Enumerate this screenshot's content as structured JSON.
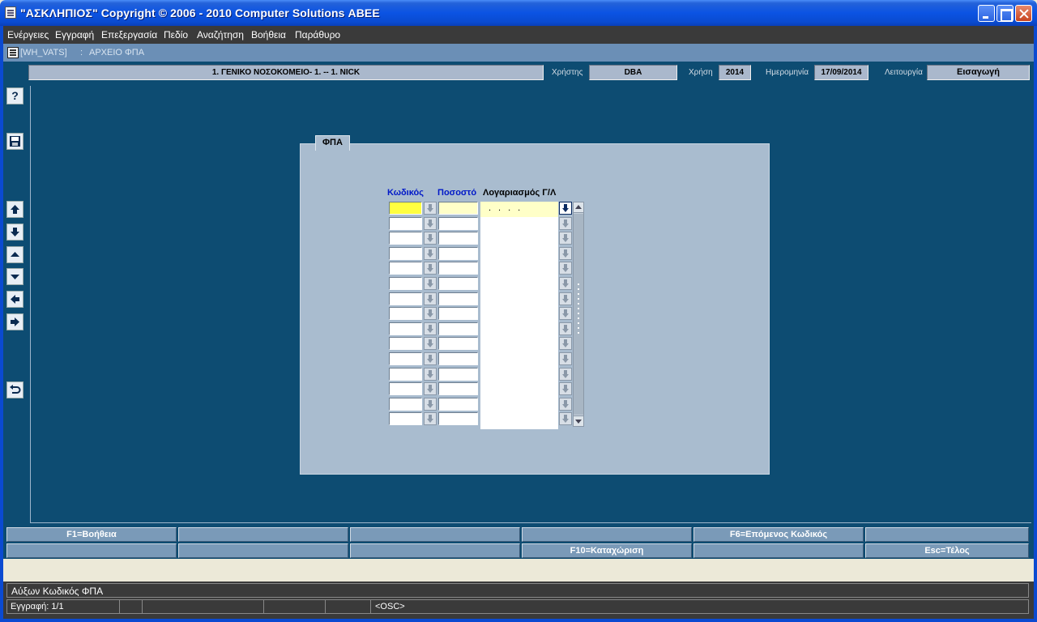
{
  "window": {
    "title": "\"ΑΣΚΛΗΠΙΟΣ\" Copyright © 2006 - 2010 Computer Solutions ΑΒΕΕ"
  },
  "menu": {
    "items": [
      "Ενέργειες",
      "Εγγραφή",
      "Επεξεργασία",
      "Πεδίο",
      "Αναζήτηση",
      "Βοήθεια",
      "Παράθυρο"
    ]
  },
  "document": {
    "form_name": "[WH_VATS]",
    "separator": ":",
    "title": "ΑΡΧΕΙΟ ΦΠΑ"
  },
  "header": {
    "organization": "1. ΓΕΝΙΚΟ ΝΟΣΟΚΟΜΕΙΟ- 1. -- 1. NICK",
    "user_label": "Χρήστης",
    "user_value": "DBA",
    "year_label": "Χρήση",
    "year_value": "2014",
    "date_label": "Ημερομηνία",
    "date_value": "17/09/2014",
    "mode_label": "Λειτουργία",
    "mode_value": "Εισαγωγή"
  },
  "toolbar": {
    "help_label": "?"
  },
  "form": {
    "tab_label": "ΦΠΑ",
    "col_code": "Κωδικός",
    "col_percent": "Ποσοστό",
    "col_account": "Λογαριασμός Γ/Λ",
    "first_account_mask": "....",
    "row_count": 15,
    "current_row": 1
  },
  "function_keys": {
    "row1": [
      "F1=Βοήθεια",
      "",
      "",
      "",
      "F6=Επόμενος Κωδικός",
      ""
    ],
    "row2": [
      "",
      "",
      "",
      "F10=Καταχώριση",
      "",
      "Esc=Τέλος"
    ]
  },
  "status": {
    "message": "Αύξων Κωδικός ΦΠΑ",
    "record": "Εγγραφή: 1/1",
    "osc": "<OSC>"
  },
  "colors": {
    "mdi_background": "#0d4c72",
    "panel": "#a9bccf",
    "current_field": "#ffff40",
    "header_blue": "#0018c8"
  }
}
